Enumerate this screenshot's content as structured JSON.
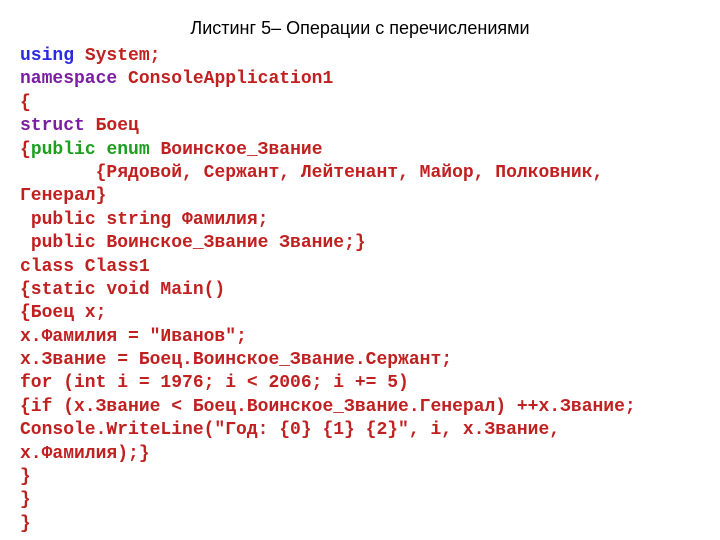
{
  "title": "Листинг 5– Операции с перечислениями",
  "code": {
    "l1": {
      "using": "using",
      "system": "System;"
    },
    "l2": {
      "namespace": "namespace",
      "name": "ConsoleApplication1"
    },
    "l3": "{",
    "l4": {
      "struct": "struct",
      "name": "Боец"
    },
    "l5": {
      "brace": "{",
      "public": "public",
      "enum": "enum",
      "name": "Воинское_Звание"
    },
    "l6": "       {Рядовой, Сержант, Лейтенант, Майор, Полковник, Генерал}",
    "l7": " public string Фамилия;",
    "l8": " public Воинское_Звание Звание;}",
    "l9": "class Class1",
    "l10": "{static void Main()",
    "l11": "{Боец x;",
    "l12": "x.Фамилия = \"Иванов\";",
    "l13": "x.Звание = Боец.Воинское_Звание.Сержант;",
    "l14": "for (int i = 1976; i < 2006; i += 5)",
    "l15": "{if (x.Звание < Боец.Воинское_Звание.Генерал) ++x.Звание;",
    "l16": "Console.WriteLine(\"Год: {0} {1} {2}\", i, x.Звание, x.Фамилия);}",
    "l17": "}",
    "l18": "}",
    "l19": "}"
  }
}
